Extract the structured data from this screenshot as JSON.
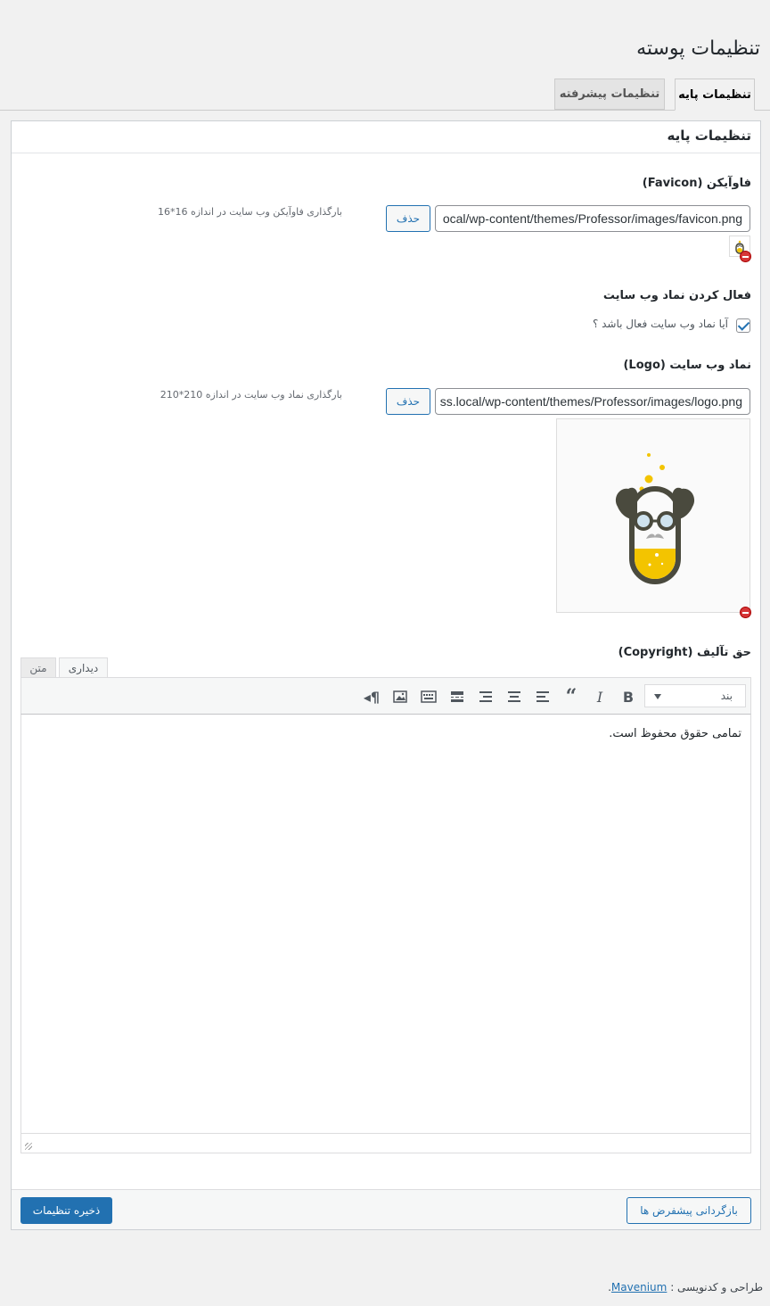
{
  "page": {
    "title": "تنظیمات پوسته"
  },
  "tabs": [
    {
      "label": "تنظیمات پایه",
      "active": true
    },
    {
      "label": "تنظیمات پیشرفته",
      "active": false
    }
  ],
  "panel": {
    "title": "تنظیمات پایه",
    "favicon": {
      "label": "فاوآیکن (Favicon)",
      "url": "ocal/wp-content/themes/Professor/images/favicon.png",
      "delete_label": "حذف",
      "hint": "بارگذاری فاوآیکن وب سایت در اندازه 16*16"
    },
    "logo_toggle": {
      "label": "فعال کردن نماد وب سایت",
      "checkbox_label": "آیا نماد وب سایت فعال باشد ؟",
      "checked": true
    },
    "logo": {
      "label": "نماد وب سایت (Logo)",
      "url": "ss.local/wp-content/themes/Professor/images/logo.png",
      "delete_label": "حذف",
      "hint": "بارگذاری نماد وب سایت در اندازه 210*210"
    },
    "copyright": {
      "label": "حق تآلیف (Copyright)",
      "tab_visual": "دیداری",
      "tab_text": "متن",
      "format_value": "بند",
      "content": "تمامی حقوق محفوظ است."
    },
    "buttons": {
      "save": "ذخیره تنظیمات",
      "reset": "بازگردانی پیشفرض ها"
    }
  },
  "credit": {
    "prefix": "طراحی و کدنویسی :",
    "link": "Mavenium",
    "suffix": "."
  },
  "colors": {
    "primary": "#2271b1",
    "logo_yellow": "#f3c400",
    "logo_dark": "#4a4a3e"
  }
}
